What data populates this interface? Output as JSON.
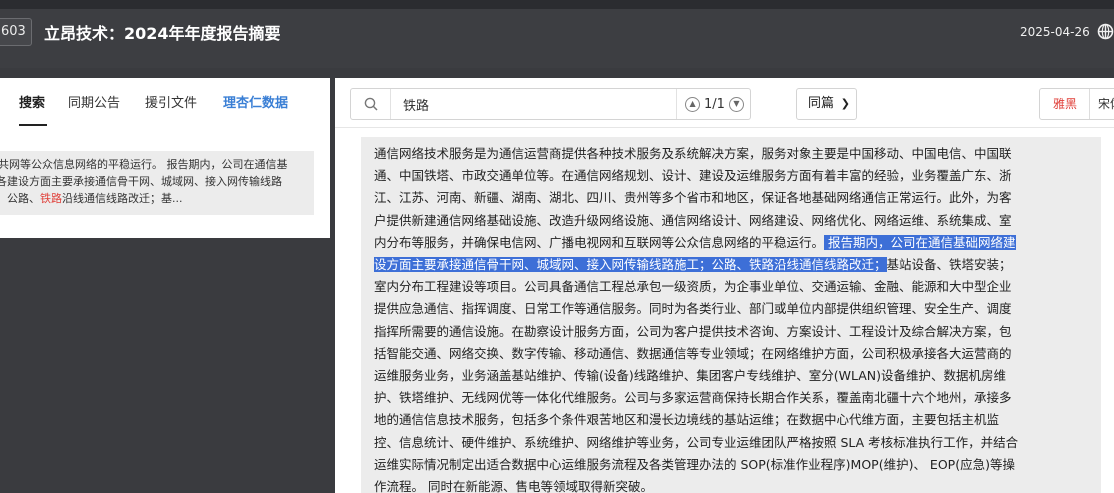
{
  "header": {
    "code": "603",
    "title": "立昂技术：2024年年度报告摘要",
    "date": "2025-04-26",
    "globe_icon": "globe-icon"
  },
  "left_panel": {
    "tabs": [
      "搜索",
      "同期公告",
      "援引文件",
      "理杏仁数据"
    ],
    "active_tab": "搜索",
    "result_lines": [
      "共网等公众信息网络的平稳运行。 报告期内，公司在通信基",
      "各建设方面主要承接通信骨干网、城域网、接入网传输线路",
      "，公路、",
      "铁路",
      "沿线通信线路改迁；基..."
    ]
  },
  "toolbar": {
    "search_value": "铁路",
    "match_counter": "1/1",
    "select_value": "同篇",
    "font_options": [
      "雅黑",
      "宋体"
    ]
  },
  "document": {
    "lines": [
      [
        {
          "t": "通信网络技术服务是为通信运营商提供各种技术服务及系统解决方案，服务对象主要是中国移动、中国电信、中国联",
          "s": 0
        }
      ],
      [
        {
          "t": "通、中国铁塔、市政交通单位等。在通信网络规划、设计、建设及运维服务方面有着丰富的经验，业务覆盖广东、浙",
          "s": 0
        }
      ],
      [
        {
          "t": "江、江苏、河南、新疆、湖南、湖北、四川、贵州等多个省市和地区，保证各地基础网络通信正常运行。此外，为客",
          "s": 0
        }
      ],
      [
        {
          "t": "户提供新建通信网络基础设施、改造升级网络设施、通信网络设计、网络建设、网络优化、网络运维、系统集成、室",
          "s": 0
        }
      ],
      [
        {
          "t": "内分布等服务，并确保电信网、广播电视网和互联网等公众信息网络的平稳运行。",
          "s": 0
        },
        {
          "t": " 报告期内，公司在通信基础网络建",
          "s": 1
        }
      ],
      [
        {
          "t": "设方面主要承接通信骨干网、城域网、接入网传输线路施工；公路、铁路沿线通信线路改迁；",
          "s": 1
        },
        {
          "t": "基站设备、铁塔安装；",
          "s": 0
        }
      ],
      [
        {
          "t": "室内分布工程建设等项目。公司具备通信工程总承包一级资质，为企事业单位、交通运输、金融、能源和大中型企业",
          "s": 0
        }
      ],
      [
        {
          "t": "提供应急通信、指挥调度、日常工作等通信服务。同时为各类行业、部门或单位内部提供组织管理、安全生产、调度",
          "s": 0
        }
      ],
      [
        {
          "t": "指挥所需要的通信设施。在勘察设计服务方面，公司为客户提供技术咨询、方案设计、工程设计及综合解决方案，包",
          "s": 0
        }
      ],
      [
        {
          "t": "括智能交通、网络交换、数字传输、移动通信、数据通信等专业领域；在网络维护方面，公司积极承接各大运营商的",
          "s": 0
        }
      ],
      [
        {
          "t": "运维服务业务，业务涵盖基站维护、传输(设备)线路维护、集团客户专线维护、室分(WLAN)设备维护、数据机房维",
          "s": 0
        }
      ],
      [
        {
          "t": "护、铁塔维护、无线网优等一体化代维服务。公司与多家运营商保持长期合作关系，覆盖南北疆十六个地州，承接多",
          "s": 0
        }
      ],
      [
        {
          "t": "地的通信信息技术服务，包括多个条件艰苦地区和漫长边境线的基站运维；在数据中心代维方面，主要包括主机监",
          "s": 0
        }
      ],
      [
        {
          "t": "控、信息统计、硬件维护、系统维护、网络维护等业务，公司专业运维团队严格按照 SLA 考核标准执行工作，并结合",
          "s": 0
        }
      ],
      [
        {
          "t": "运维实际情况制定出适合数据中心运维服务流程及各类管理办法的 SOP(标准作业程序)MOP(维护)、 EOP(应急)等操",
          "s": 0
        }
      ],
      [
        {
          "t": "作流程。 同时在新能源、售电等领域取得新突破。",
          "s": 0
        }
      ]
    ]
  },
  "colors": {
    "header_bg": "#3d3e42",
    "selection": "#3d6fd7",
    "keyword_red": "#e0403a",
    "link_blue": "#3a7fd5"
  }
}
